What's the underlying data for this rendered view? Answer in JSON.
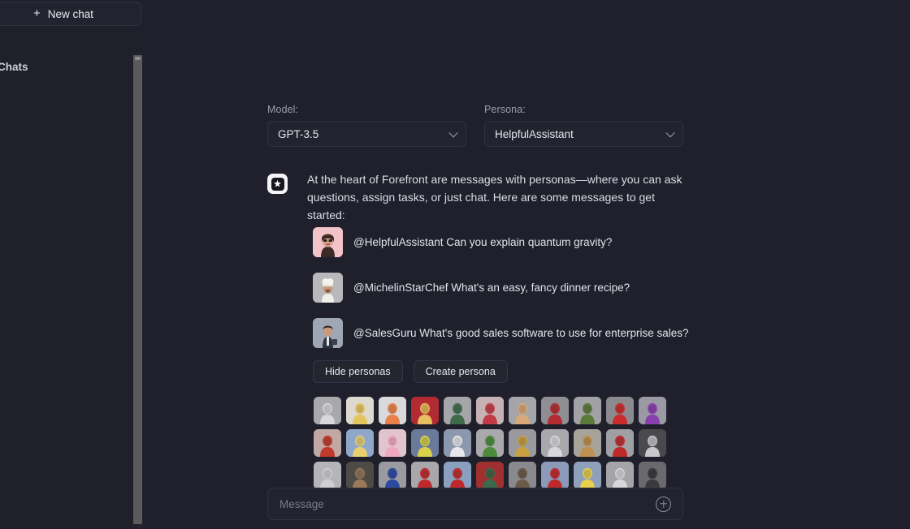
{
  "colors": {
    "app_bg": "#20202c",
    "sidebar_bg": "#20202b",
    "panel_bg": "#23232f",
    "border": "#32323f",
    "text_primary": "#e6e6ef",
    "text_muted": "#9c9cae",
    "scrollbar": "#5b5b5b"
  },
  "sidebar": {
    "new_chat_label": "New chat",
    "new_chat_icon": "plus-icon",
    "section_label": "Chats",
    "section_chevron": "chevron-right-icon"
  },
  "selects": {
    "model": {
      "label": "Model:",
      "value": "GPT-3.5",
      "caret_icon": "chevron-down-icon",
      "options": [
        "GPT-3.5"
      ]
    },
    "persona": {
      "label": "Persona:",
      "value": "HelpfulAssistant",
      "caret_icon": "chevron-down-icon",
      "options": [
        "HelpfulAssistant"
      ]
    }
  },
  "intro": {
    "logo_icon": "forefront-sparkle-icon",
    "text": "At the heart of Forefront are messages with personas—where you can ask questions, assign tasks, or just chat. Here are some messages to get started:"
  },
  "suggested_messages": [
    {
      "avatar_name": "avatar-helpful-assistant",
      "avatar_bg": "#f2c3c8",
      "text": "@HelpfulAssistant Can you explain quantum gravity?"
    },
    {
      "avatar_name": "avatar-michelin-star-chef",
      "avatar_bg": "#b9b9bc",
      "text": "@MichelinStarChef What's an easy, fancy dinner recipe?"
    },
    {
      "avatar_name": "avatar-sales-guru",
      "avatar_bg": "#9fa6b4",
      "text": "@SalesGuru What's good sales software to use for enterprise sales?"
    }
  ],
  "actions": {
    "hide_personas_label": "Hide personas",
    "create_persona_label": "Create persona"
  },
  "persona_grid": {
    "rows": [
      [
        {
          "name": "persona-scientist",
          "bg": "#a9a9ac",
          "accent": "#d8d8dc"
        },
        {
          "name": "persona-yellow-creature",
          "bg": "#ddd9cf",
          "accent": "#e4c55d"
        },
        {
          "name": "persona-boy-suit",
          "bg": "#d9d9dc",
          "accent": "#e8804a"
        },
        {
          "name": "persona-wonder-woman",
          "bg": "#b22b32",
          "accent": "#e8c060"
        },
        {
          "name": "persona-green-hat-figure",
          "bg": "#a6a6aa",
          "accent": "#3f6b4a"
        },
        {
          "name": "persona-mouse-character",
          "bg": "#c6b2b4",
          "accent": "#c23a46"
        },
        {
          "name": "persona-muscle-figure",
          "bg": "#a5a5a9",
          "accent": "#d8a878"
        },
        {
          "name": "persona-red-robot",
          "bg": "#8e8e93",
          "accent": "#b22b32"
        },
        {
          "name": "persona-green-soldier",
          "bg": "#a2a2a6",
          "accent": "#5a7a3a"
        },
        {
          "name": "persona-red-blob",
          "bg": "#8a8a8f",
          "accent": "#cc2b2b"
        },
        {
          "name": "persona-purple-jester",
          "bg": "#9b9aa4",
          "accent": "#8a3fb0"
        }
      ],
      [
        {
          "name": "persona-red-hair-woman",
          "bg": "#c2a8a4",
          "accent": "#c0392b"
        },
        {
          "name": "persona-moon-girl",
          "bg": "#8fa7c8",
          "accent": "#e8d070"
        },
        {
          "name": "persona-ice-queen",
          "bg": "#e0c5cf",
          "accent": "#f0a8c0"
        },
        {
          "name": "persona-starry-figure",
          "bg": "#6a7a9a",
          "accent": "#d8d04a"
        },
        {
          "name": "persona-politician",
          "bg": "#8b98ae",
          "accent": "#e8e8ec"
        },
        {
          "name": "persona-frog-suit",
          "bg": "#a9a9ad",
          "accent": "#4a8a3a"
        },
        {
          "name": "persona-gold-helmet",
          "bg": "#9a9a9e",
          "accent": "#c8a040"
        },
        {
          "name": "persona-philosopher",
          "bg": "#a9a9ad",
          "accent": "#d8d8dc"
        },
        {
          "name": "persona-headphones-woman",
          "bg": "#a8a39a",
          "accent": "#c09050"
        },
        {
          "name": "persona-red-hat-clown",
          "bg": "#a0a0a4",
          "accent": "#c0292b"
        },
        {
          "name": "persona-gentleman",
          "bg": "#4a4a4e",
          "accent": "#c8c8cc"
        }
      ],
      [
        {
          "name": "persona-silver-creature",
          "bg": "#b5b5b9",
          "accent": "#d0d0d4"
        },
        {
          "name": "persona-glasses-man",
          "bg": "#4e4a46",
          "accent": "#9a7a5a"
        },
        {
          "name": "persona-blue-spiky-hair",
          "bg": "#9a9aa0",
          "accent": "#2a4aa0"
        },
        {
          "name": "persona-mouse-red",
          "bg": "#a8a8ac",
          "accent": "#c0292b"
        },
        {
          "name": "persona-plumber",
          "bg": "#8aa0c0",
          "accent": "#c0292b"
        },
        {
          "name": "persona-detective-red",
          "bg": "#a03030",
          "accent": "#3a6a4a"
        },
        {
          "name": "persona-hat-figure",
          "bg": "#8a8a8e",
          "accent": "#6a5a4a"
        },
        {
          "name": "persona-duck-sailor",
          "bg": "#8a9ab8",
          "accent": "#c0292b"
        },
        {
          "name": "persona-yellow-cartoon",
          "bg": "#8fa0bc",
          "accent": "#e8d04a"
        },
        {
          "name": "persona-einstein",
          "bg": "#a5a5a9",
          "accent": "#d8d8dc"
        },
        {
          "name": "persona-mustache-man",
          "bg": "#6a6a6e",
          "accent": "#3a3a3e"
        }
      ]
    ]
  },
  "composer": {
    "placeholder": "Message",
    "value": "",
    "attach_icon": "plus-circle-icon"
  }
}
